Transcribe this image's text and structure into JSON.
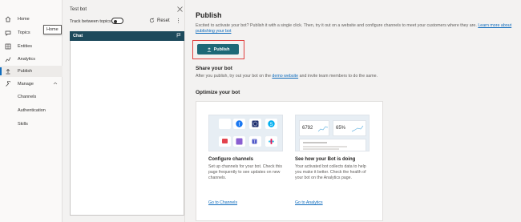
{
  "nav": {
    "items": [
      {
        "label": "Home",
        "icon": "home-icon"
      },
      {
        "label": "Topics",
        "icon": "topics-icon"
      },
      {
        "label": "Entities",
        "icon": "entities-icon"
      },
      {
        "label": "Analytics",
        "icon": "analytics-icon"
      },
      {
        "label": "Publish",
        "icon": "publish-icon"
      },
      {
        "label": "Manage",
        "icon": "manage-icon"
      },
      {
        "label": "Channels"
      },
      {
        "label": "Authentication"
      },
      {
        "label": "Skills"
      }
    ],
    "tooltip": "Home"
  },
  "testbot": {
    "title": "Test bot",
    "track_label": "Track between topics",
    "reset_label": "Reset",
    "more": "⋮",
    "chat_label": "Chat"
  },
  "main": {
    "title": "Publish",
    "intro": "Excited to activate your bot? Publish it with a single click. Then, try it out on a website and configure channels to meet your customers where they are.",
    "intro_link": "Learn more about publishing your bot",
    "publish_label": "Publish",
    "share_title": "Share your bot",
    "share_before": "After you publish, try out your bot on the",
    "share_link": "demo website",
    "share_after": "and invite team members to do the same.",
    "optimize_title": "Optimize your bot",
    "cards": [
      {
        "title": "Configure channels",
        "desc": "Set up channels for your bot. Check this page frequently to see updates on new channels.",
        "link": "Go to Channels"
      },
      {
        "title": "See how your Bot is doing",
        "desc": "Your activated bot collects data to help you make it better. Check the health of your bot on the Analytics page.",
        "link": "Go to Analytics",
        "stat1": "6792",
        "stat2": "65%"
      }
    ]
  },
  "colors": {
    "accent": "#1d6877",
    "chat_header": "#1d4a5c",
    "link": "#0f6cbd",
    "highlight": "#e0403f"
  }
}
